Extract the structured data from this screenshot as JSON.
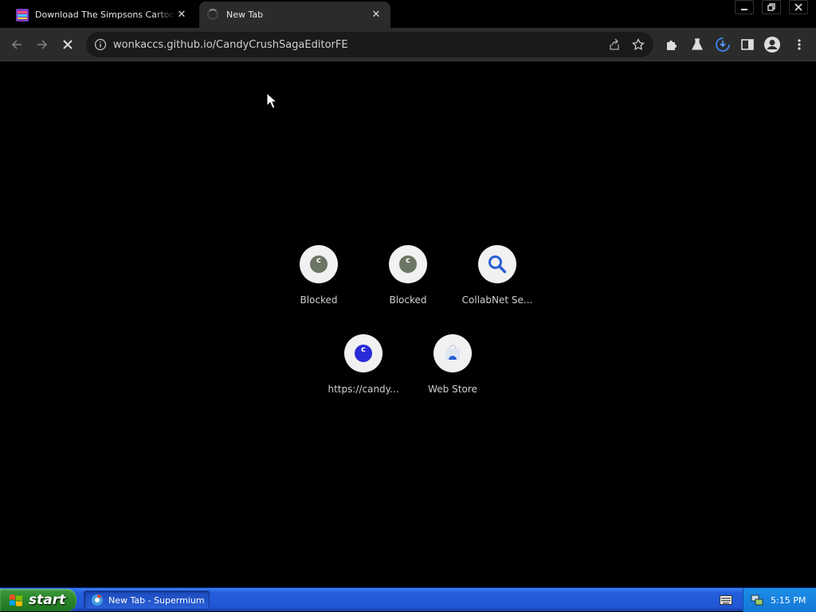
{
  "browser": {
    "tabs": [
      {
        "title": "Download The Simpsons Cartoon Sh",
        "active": false
      },
      {
        "title": "New Tab",
        "active": true
      }
    ],
    "url": "wonkaccs.github.io/CandyCrushSagaEditorFE"
  },
  "new_tab": {
    "shortcuts": [
      {
        "label": "Blocked",
        "icon": "letter-c-gray-icon"
      },
      {
        "label": "Blocked",
        "icon": "letter-c-gray-icon"
      },
      {
        "label": "CollabNet Se...",
        "icon": "search-icon"
      },
      {
        "label": "https://candy...",
        "icon": "letter-c-blue-icon"
      },
      {
        "label": "Web Store",
        "icon": "web-store-icon"
      }
    ]
  },
  "taskbar": {
    "start_label": "start",
    "window_button": "New Tab - Supermium",
    "clock": "5:15 PM"
  },
  "colors": {
    "page_bg": "#000000",
    "toolbar_bg": "#2b2b2b",
    "taskbar_blue": "#245edc",
    "start_green": "#2d8a2d",
    "shortcut_gray_c": "#6b7563",
    "shortcut_blue_c": "#2a2ad8"
  }
}
